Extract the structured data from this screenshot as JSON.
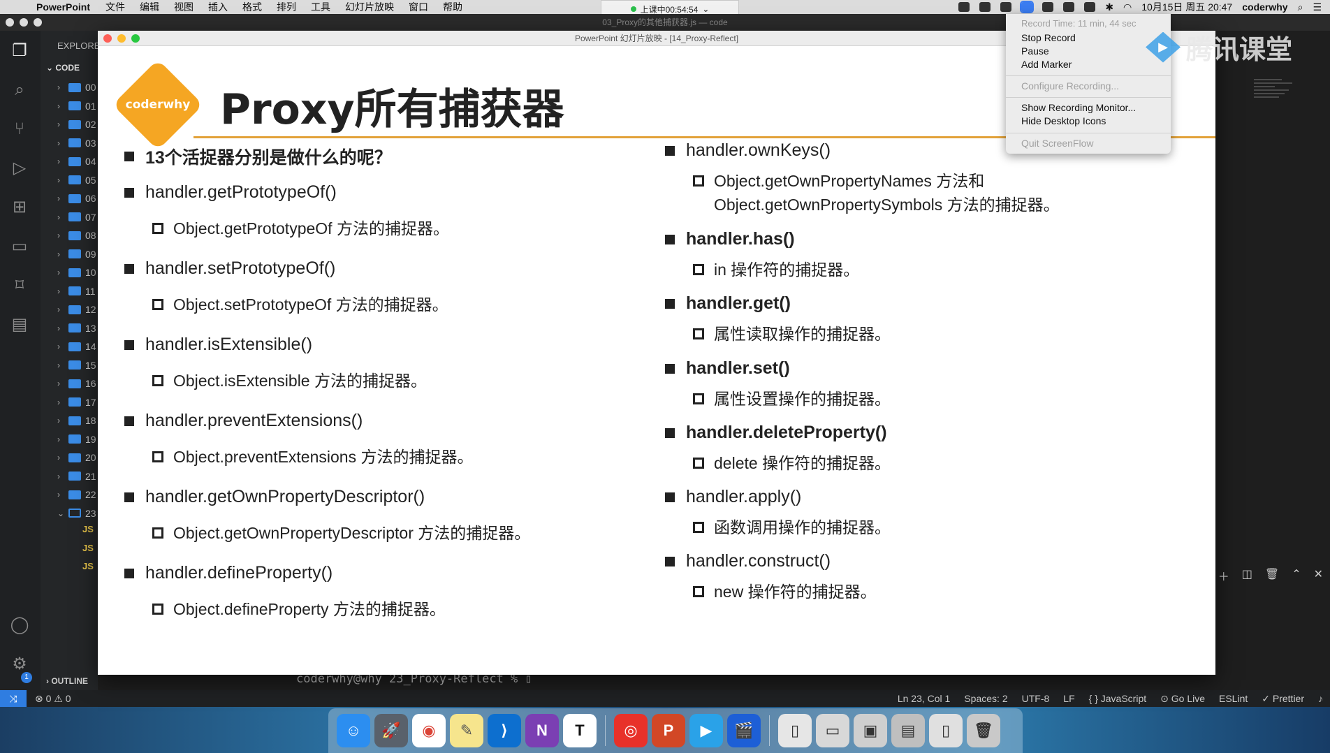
{
  "menubar": {
    "app": "PowerPoint",
    "items": [
      "文件",
      "编辑",
      "视图",
      "插入",
      "格式",
      "排列",
      "工具",
      "幻灯片放映",
      "窗口",
      "帮助"
    ],
    "recording_pill": "上课中00:54:54",
    "clock": "10月15日 周五 20:47",
    "user": "coderwhy"
  },
  "vscode": {
    "window_title": "03_Proxy的其他捕获器.js — code",
    "explorer_header": "EXPLORE",
    "section_label": "CODE",
    "folders": [
      "00",
      "01",
      "02",
      "03",
      "04",
      "05",
      "06",
      "07",
      "08",
      "09",
      "10",
      "11",
      "12",
      "13",
      "14",
      "15",
      "16",
      "17",
      "18",
      "19",
      "20",
      "21",
      "22",
      "23"
    ],
    "files": [
      "JS",
      "JS",
      "JS"
    ],
    "outline_label": "OUTLINE",
    "terminal_prompt": "coderwhy@why 23_Proxy-Reflect % ",
    "settings_badge": "1",
    "status": {
      "errors": "0",
      "warnings": "0",
      "position": "Ln 23, Col 1",
      "spaces": "Spaces: 2",
      "encoding": "UTF-8",
      "eol": "LF",
      "language": "JavaScript",
      "golive": "Go Live",
      "eslint": "ESLint",
      "prettier": "Prettier"
    }
  },
  "ppt": {
    "window_title": "PowerPoint 幻灯片放映 - [14_Proxy-Reflect]",
    "logo": "coderwhy",
    "title": "Proxy所有捕获器",
    "left": [
      {
        "text": "13个活捉器分别是做什么的呢？",
        "bold": true
      },
      {
        "text": "handler.getPrototypeOf()",
        "sub": "Object.getPrototypeOf 方法的捕捉器。"
      },
      {
        "text": "handler.setPrototypeOf()",
        "sub": "Object.setPrototypeOf 方法的捕捉器。"
      },
      {
        "text": "handler.isExtensible()",
        "sub": "Object.isExtensible 方法的捕捉器。"
      },
      {
        "text": "handler.preventExtensions()",
        "sub": "Object.preventExtensions 方法的捕捉器。"
      },
      {
        "text": "handler.getOwnPropertyDescriptor()",
        "sub": "Object.getOwnPropertyDescriptor 方法的捕捉器。"
      },
      {
        "text": "handler.defineProperty()",
        "sub": "Object.defineProperty 方法的捕捉器。"
      }
    ],
    "right": [
      {
        "text": "handler.ownKeys()",
        "sub1": "Object.getOwnPropertyNames 方法和",
        "sub2": "Object.getOwnPropertySymbols 方法的捕捉器。"
      },
      {
        "text": "handler.has()",
        "sub": "in 操作符的捕捉器。"
      },
      {
        "text": "handler.get()",
        "sub": "属性读取操作的捕捉器。"
      },
      {
        "text": "handler.set()",
        "sub": "属性设置操作的捕捉器。"
      },
      {
        "text": "handler.deleteProperty()",
        "sub": "delete 操作符的捕捉器。"
      },
      {
        "text": "handler.apply()",
        "sub": "函数调用操作的捕捉器。"
      },
      {
        "text": "handler.construct()",
        "sub": "new 操作符的捕捉器。"
      }
    ]
  },
  "screenflow_menu": {
    "record_time": "Record Time: 11 min, 44 sec",
    "stop": "Stop Record",
    "pause": "Pause",
    "marker": "Add Marker",
    "configure": "Configure Recording...",
    "monitor": "Show Recording Monitor...",
    "hide_icons": "Hide Desktop Icons",
    "quit": "Quit ScreenFlow"
  },
  "watermark": "腾讯课堂",
  "dock": {
    "notes_letter": "N",
    "typora_letter": "T"
  }
}
